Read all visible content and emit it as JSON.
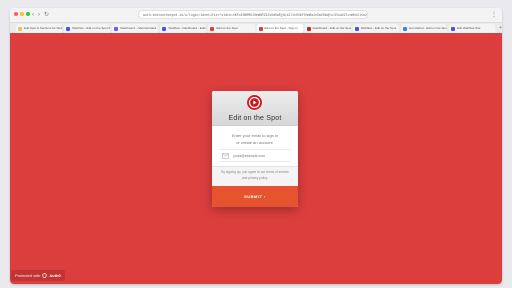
{
  "browser": {
    "url": "auth.editonthespot.io/u/login/identifier?state=hKFo2SBRM0J0eWNPZ3ZsUm5wRjNLX2lIc0VmT0hmRmJnUmZ5WqFur3VuaXZlcnNhbC1sb2dpbg",
    "tabs": [
      {
        "label": "Edit Spot & Sections for Webflow",
        "favicon_color": "#f2c14e"
      },
      {
        "label": "Webflow - Edit on the Spot Site",
        "favicon_color": "#4353ff"
      },
      {
        "label": "Dashboard – Memberstack",
        "favicon_color": "#6b5cff"
      },
      {
        "label": "Webflow - Dashboard - Editor",
        "favicon_color": "#4353ff"
      },
      {
        "label": "Edit on the Spot",
        "favicon_color": "#dc3e3e"
      },
      {
        "label": "Edit on the Spot - Sign in",
        "favicon_color": "#dc3e3e"
      },
      {
        "label": "Dashboard - Edit on the Spot",
        "favicon_color": "#d02020"
      },
      {
        "label": "Webflow - Edit on the Spot",
        "favicon_color": "#4353ff"
      },
      {
        "label": "Get started - Edit on the Spot",
        "favicon_color": "#3b82f6"
      },
      {
        "label": "Edit Webflow Site",
        "favicon_color": "#4353ff"
      }
    ]
  },
  "colors": {
    "page_background": "#dc3e3e",
    "submit_button": "#e5542e",
    "logo": "#c8181e"
  },
  "login": {
    "logo_icon": "play-badge-icon",
    "title": "Edit on the Spot",
    "lead_line1": "Enter your email to sign in",
    "lead_line2": "or create an account.",
    "email_placeholder": "yours@example.com",
    "email_value": "",
    "terms_line1": "By signing up, you agree to our terms of service",
    "terms_line2": "and privacy policy.",
    "submit_label": "SUBMIT ›"
  },
  "badge": {
    "prefix": "Protected with",
    "brand": "Auth0"
  }
}
